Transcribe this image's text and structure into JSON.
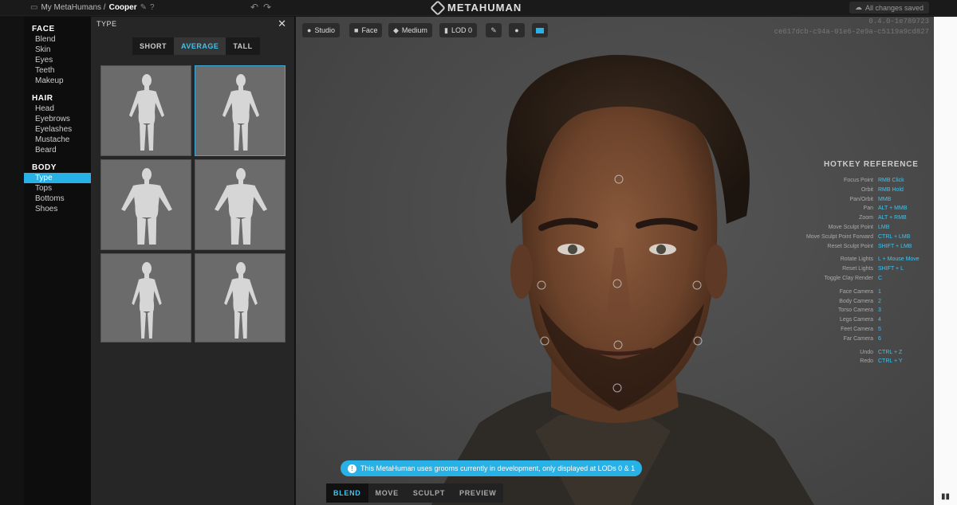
{
  "topbar": {
    "breadcrumb_root": "My MetaHumans /",
    "breadcrumb_current": "Cooper",
    "logo": "METAHUMAN",
    "saved_status": "All changes saved"
  },
  "nav": {
    "sections": [
      {
        "title": "FACE",
        "items": [
          "Blend",
          "Skin",
          "Eyes",
          "Teeth",
          "Makeup"
        ]
      },
      {
        "title": "HAIR",
        "items": [
          "Head",
          "Eyebrows",
          "Eyelashes",
          "Mustache",
          "Beard"
        ]
      },
      {
        "title": "BODY",
        "items": [
          "Type",
          "Tops",
          "Bottoms",
          "Shoes"
        ]
      }
    ],
    "active_item": "Type"
  },
  "panel": {
    "title": "TYPE",
    "close": "✕",
    "heights": [
      "SHORT",
      "AVERAGE",
      "TALL"
    ],
    "active_height": "AVERAGE"
  },
  "viewport": {
    "toolbar": {
      "lighting": "Studio",
      "camera": "Face",
      "quality": "Medium",
      "lod": "LOD 0"
    },
    "version_line1": "0.4.0-1e789723",
    "version_line2": "ce617dcb-c94a-01e6-2e9a-c5119a9cd827",
    "hotkey_title": "HOTKEY REFERENCE",
    "hotkeys": [
      {
        "label": "Focus Point",
        "key": "RMB Click"
      },
      {
        "label": "Orbit",
        "key": "RMB Hold"
      },
      {
        "label": "Pan/Orbit",
        "key": "MMB"
      },
      {
        "label": "Pan",
        "key": "ALT + MMB"
      },
      {
        "label": "Zoom",
        "key": "ALT + RMB"
      },
      {
        "label": "Move Sculpt Point",
        "key": "LMB"
      },
      {
        "label": "Move Sculpt Point Forward",
        "key": "CTRL + LMB"
      },
      {
        "label": "Reset Sculpt Point",
        "key": "SHIFT + LMB"
      },
      {
        "gap": true
      },
      {
        "label": "Rotate Lights",
        "key": "L + Mouse Move"
      },
      {
        "label": "Reset Lights",
        "key": "SHIFT + L"
      },
      {
        "label": "Toggle Clay Render",
        "key": "C"
      },
      {
        "gap": true
      },
      {
        "label": "Face Camera",
        "key": "1"
      },
      {
        "label": "Body Camera",
        "key": "2"
      },
      {
        "label": "Torso Camera",
        "key": "3"
      },
      {
        "label": "Legs Camera",
        "key": "4"
      },
      {
        "label": "Feet Camera",
        "key": "5"
      },
      {
        "label": "Far Camera",
        "key": "6"
      },
      {
        "gap": true
      },
      {
        "label": "Undo",
        "key": "CTRL + Z"
      },
      {
        "label": "Redo",
        "key": "CTRL + Y"
      }
    ],
    "notice": "This MetaHuman uses grooms currently in development, only displayed at LODs 0 & 1",
    "modes": [
      "BLEND",
      "MOVE",
      "SCULPT",
      "PREVIEW"
    ],
    "active_mode": "BLEND"
  }
}
